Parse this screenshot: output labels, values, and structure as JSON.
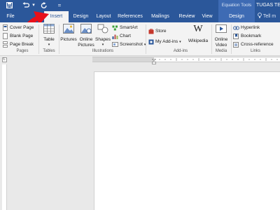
{
  "qat": {
    "save_icon": "save-icon",
    "undo_icon": "undo-icon",
    "undo_dropdown": "▾",
    "redo_icon": "redo-icon",
    "customize_icon": "customize-qat-icon",
    "customize_glyph": "="
  },
  "contextual": {
    "label": "Equation Tools"
  },
  "title": "TUGAS TE",
  "tabs": [
    {
      "label": "File"
    },
    {
      "label": "Insert"
    },
    {
      "label": "Design"
    },
    {
      "label": "Layout"
    },
    {
      "label": "References"
    },
    {
      "label": "Mailings"
    },
    {
      "label": "Review"
    },
    {
      "label": "View"
    },
    {
      "label": "Design"
    }
  ],
  "tell_me": "Tell m",
  "ribbon": {
    "pages": {
      "label": "Pages",
      "items": [
        "Cover Page",
        "Blank Page",
        "Page Break"
      ]
    },
    "tables": {
      "label": "Tables",
      "table": "Table"
    },
    "illustrations": {
      "label": "Illustrations",
      "pictures": "Pictures",
      "online_pictures_1": "Online",
      "online_pictures_2": "Pictures",
      "shapes": "Shapes",
      "smartart": "SmartArt",
      "chart": "Chart",
      "screenshot": "Screenshot"
    },
    "addins": {
      "label": "Add-ins",
      "store": "Store",
      "my_addins": "My Add-ins",
      "wikipedia": "Wikipedia"
    },
    "media": {
      "label": "Media",
      "online_video_1": "Online",
      "online_video_2": "Video"
    },
    "links": {
      "label": "Links",
      "hyperlink": "Hyperlink",
      "bookmark": "Bookmark",
      "cross_reference": "Cross-reference"
    }
  },
  "ruler": {
    "corner": "L"
  },
  "colors": {
    "accent": "#2b579a",
    "annotation_arrow": "#e8101a"
  }
}
